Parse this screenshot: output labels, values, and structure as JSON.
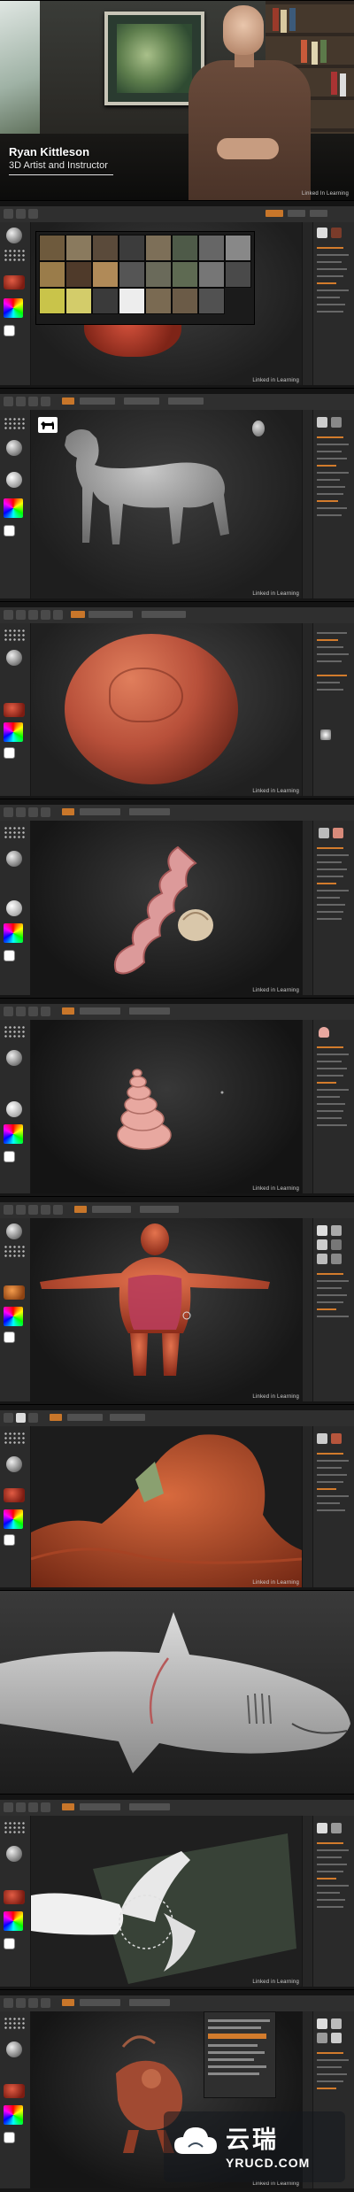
{
  "intro": {
    "name": "Ryan Kittleson",
    "role": "3D Artist and Instructor",
    "brand": "Linked In Learning"
  },
  "panels": {
    "p1_brand": "Linked in Learning",
    "p2_brand": "Linked in Learning",
    "p3_brand": "Linked in Learning",
    "p4_brand": "Linked in Learning",
    "p5_brand": "Linked in Learning",
    "p6_brand": "Linked in Learning",
    "p7_brand": "Linked in Learning",
    "p9_brand": "Linked in Learning",
    "p10_brand": "Linked in Learning"
  },
  "watermark": {
    "chinese": "云瑞",
    "url": "YRUCD.COM"
  },
  "colors": {
    "accent": "#d27b2c",
    "clay": "#b84a35",
    "panel_bg": "#252525"
  },
  "icons": {
    "cloud": "cloud-logo-icon",
    "dog": "dog-thumbnail-icon"
  }
}
